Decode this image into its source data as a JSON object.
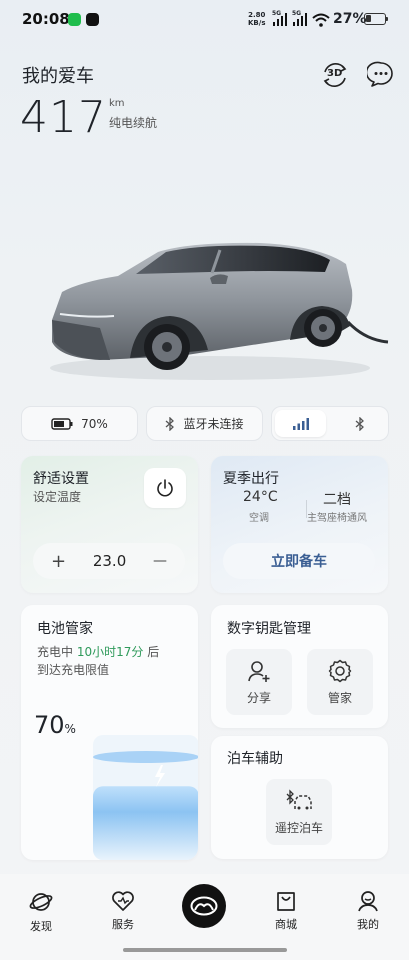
{
  "status_bar": {
    "time": "20:08",
    "speed_value": "2.80",
    "speed_unit": "KB/s",
    "signal1": "5G",
    "signal2": "5G",
    "battery_pct": "27%"
  },
  "header": {
    "title": "我的爱车",
    "range_value": "417",
    "range_unit": "km",
    "range_label": "纯电续航",
    "btn_3d_label": "3D"
  },
  "chips": {
    "battery_pct": "70%",
    "bluetooth_status": "蓝牙未连接"
  },
  "comfort": {
    "title": "舒适设置",
    "subtitle": "设定温度",
    "temp_value": "23.0",
    "plus": "+",
    "minus": "—"
  },
  "summer": {
    "title": "夏季出行",
    "temp": "24°C",
    "temp_label": "空调",
    "level": "二档",
    "level_label": "主驾座椅通风",
    "prepare_label": "立即备车"
  },
  "battery_card": {
    "title": "电池管家",
    "charging_prefix": "充电中",
    "charging_time": "10小时17分",
    "charging_suffix": "后",
    "charging_line2": "到达充电限值",
    "pct_value": "70",
    "pct_unit": "%",
    "level": 0.7
  },
  "key_card": {
    "title": "数字钥匙管理",
    "share_label": "分享",
    "manage_label": "管家"
  },
  "park_card": {
    "title": "泊车辅助",
    "remote_label": "遥控泊车"
  },
  "nav": {
    "discover": "发现",
    "service": "服务",
    "mall": "商城",
    "me": "我的"
  },
  "colors": {
    "accent_green": "#2f9a5b",
    "accent_blue": "#3a5e93"
  }
}
